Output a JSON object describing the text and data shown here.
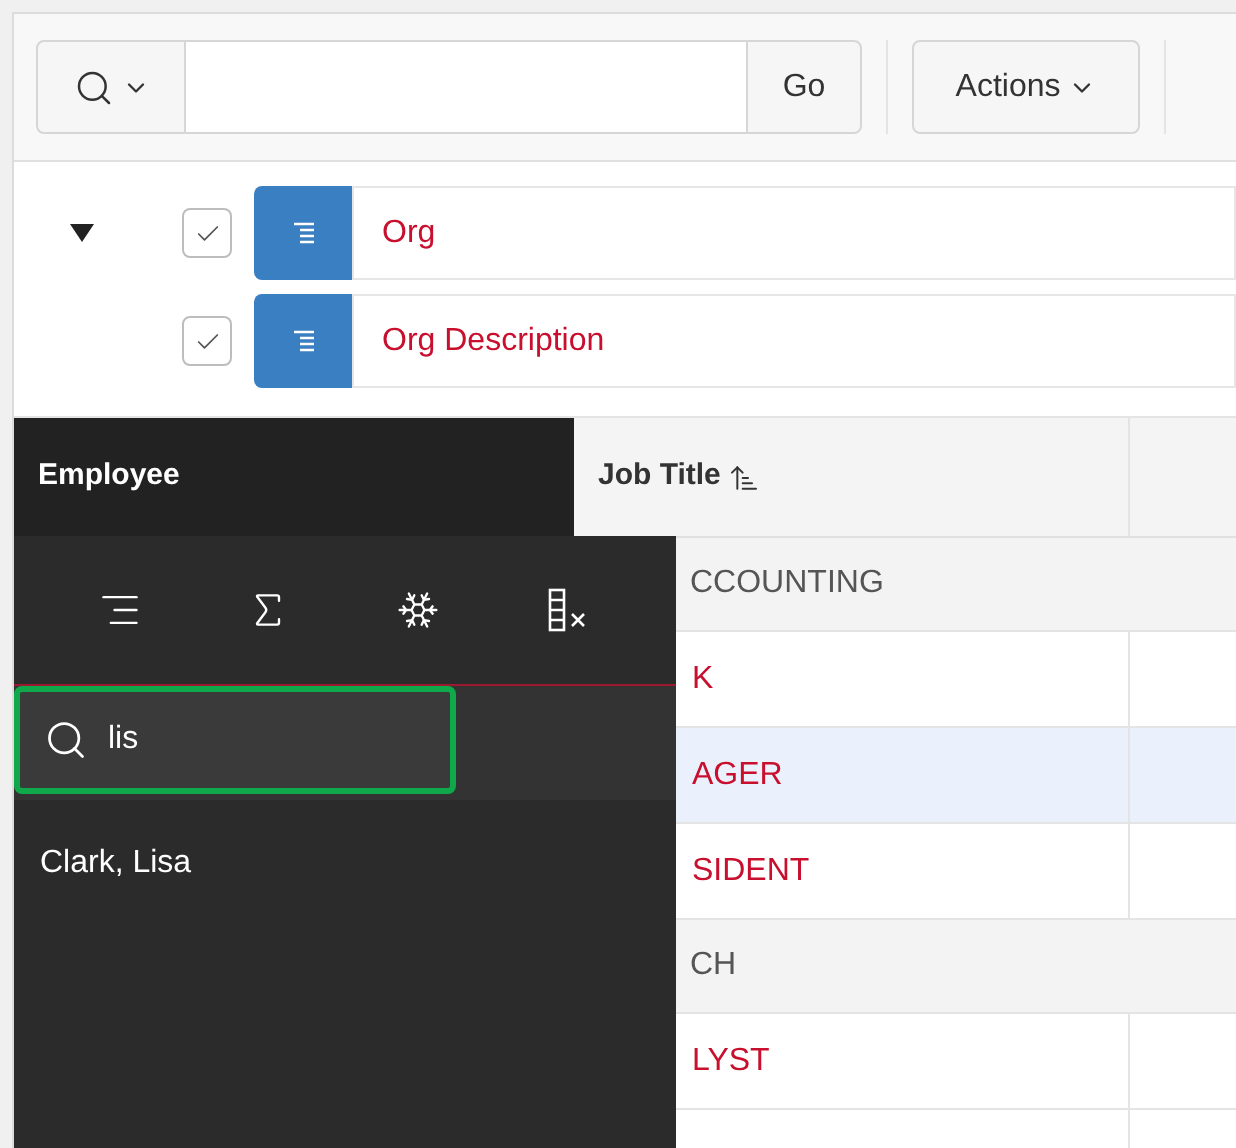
{
  "toolbar": {
    "go_button": "Go",
    "actions_button": "Actions"
  },
  "control_break_toggle": {
    "expanded": true
  },
  "control_breaks": [
    {
      "label": "Org",
      "checked": true
    },
    {
      "label": "Org Description",
      "checked": true
    }
  ],
  "columns": [
    {
      "label": "Employee",
      "active": true,
      "sorted": false
    },
    {
      "label": "Job Title",
      "active": false,
      "sorted": true
    }
  ],
  "groups": [
    {
      "label": "CCOUNTING",
      "rows": [
        {
          "job_title": "K",
          "selected": false
        },
        {
          "job_title": "AGER",
          "selected": true
        },
        {
          "job_title": "SIDENT",
          "selected": false
        }
      ]
    },
    {
      "label": "CH",
      "rows": [
        {
          "job_title": "LYST",
          "selected": false
        }
      ]
    }
  ],
  "column_menu": {
    "search_value": "lis",
    "results": [
      "Clark, Lisa"
    ]
  }
}
